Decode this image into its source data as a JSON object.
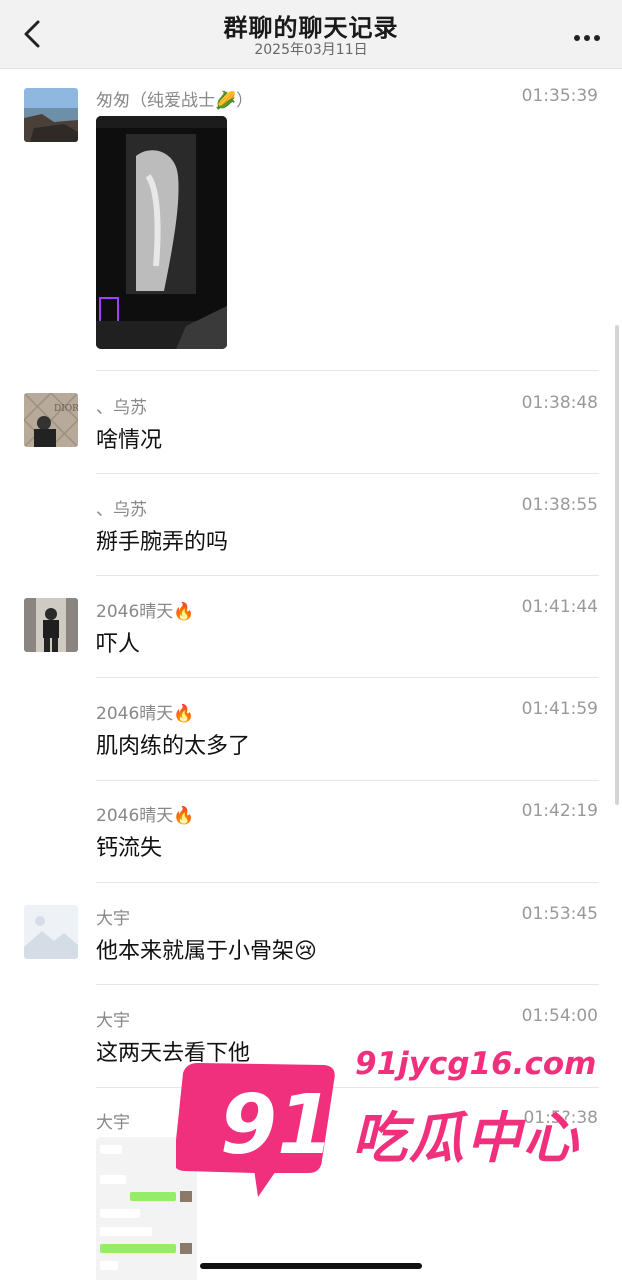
{
  "header": {
    "title": "群聊的聊天记录",
    "subtitle": "2025年03月11日"
  },
  "messages": [
    {
      "sender": "匆匆（纯爱战士",
      "sender_emoji": "🌽",
      "sender_suffix": "）",
      "time": "01:35:39",
      "type": "image",
      "avatar": "coast-photo"
    },
    {
      "sender": "、乌苏",
      "time": "01:38:48",
      "text": "啥情况",
      "avatar": "dior-photo"
    },
    {
      "sender": "、乌苏",
      "time": "01:38:55",
      "text": "掰手腕弄的吗"
    },
    {
      "sender": "2046晴天",
      "sender_emoji": "🔥",
      "time": "01:41:44",
      "text": "吓人",
      "avatar": "person-photo"
    },
    {
      "sender": "2046晴天",
      "sender_emoji": "🔥",
      "time": "01:41:59",
      "text": "肌肉练的太多了"
    },
    {
      "sender": "2046晴天",
      "sender_emoji": "🔥",
      "time": "01:42:19",
      "text": "钙流失"
    },
    {
      "sender": "大宇",
      "time": "01:53:45",
      "text": "他本来就属于小骨架",
      "text_emoji": "😢",
      "avatar": "placeholder-image"
    },
    {
      "sender": "大宇",
      "time": "01:54:00",
      "text": "这两天去看下他"
    },
    {
      "sender": "大宇",
      "time": "01:5?:38",
      "type": "image"
    }
  ],
  "watermark": {
    "number": "91",
    "url": "91jycg16.com",
    "name": "吃瓜中心"
  },
  "colors": {
    "watermark": "#f0307c",
    "header_bg": "#f2f2f2",
    "chat_green": "#95ec69"
  }
}
